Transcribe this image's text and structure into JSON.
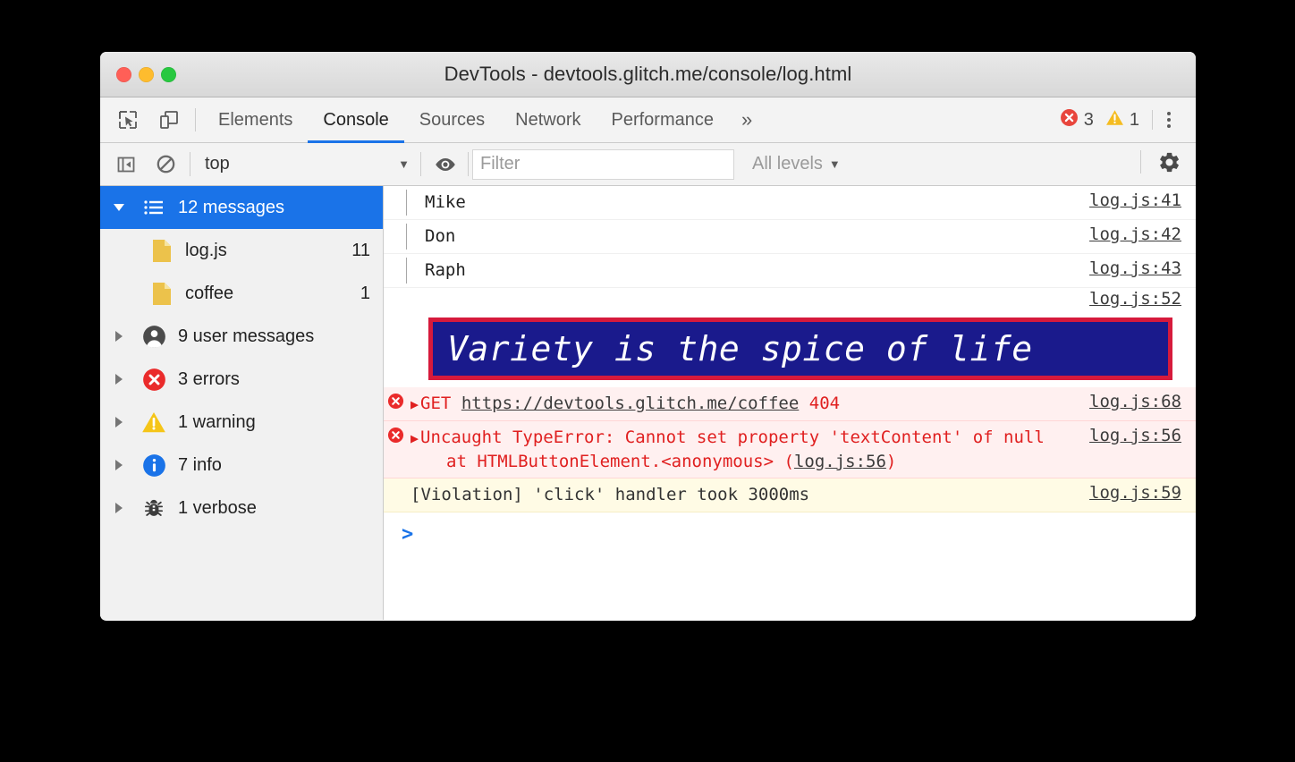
{
  "window": {
    "title": "DevTools - devtools.glitch.me/console/log.html",
    "traffic_lights": [
      "close-red",
      "minimize-yellow",
      "maximize-green"
    ]
  },
  "toolbar": {
    "inspect_icon": "inspect-element-icon",
    "device_icon": "device-toolbar-icon",
    "tabs": [
      {
        "label": "Elements",
        "active": false
      },
      {
        "label": "Console",
        "active": true
      },
      {
        "label": "Sources",
        "active": false
      },
      {
        "label": "Network",
        "active": false
      },
      {
        "label": "Performance",
        "active": false
      }
    ],
    "more_tabs_label": "»",
    "error_count": "3",
    "warning_count": "1",
    "menu_icon": "kebab-menu-icon"
  },
  "filterbar": {
    "sidebar_toggle_icon": "show-console-sidebar-icon",
    "clear_icon": "clear-console-icon",
    "context_value": "top",
    "context_caret": "▼",
    "live_expression_icon": "eye-icon",
    "filter_placeholder": "Filter",
    "filter_value": "",
    "levels_label": "All levels",
    "levels_caret": "▼",
    "settings_icon": "gear-icon"
  },
  "sidebar": {
    "items": [
      {
        "label": "12 messages",
        "count": "",
        "icon": "list-icon",
        "twisty": "down",
        "selected": true,
        "child": false
      },
      {
        "label": "log.js",
        "count": "11",
        "icon": "file-icon",
        "twisty": "",
        "selected": false,
        "child": true
      },
      {
        "label": "coffee",
        "count": "1",
        "icon": "file-icon",
        "twisty": "",
        "selected": false,
        "child": true
      },
      {
        "label": "9 user messages",
        "count": "",
        "icon": "user-icon",
        "twisty": "right",
        "selected": false,
        "child": false
      },
      {
        "label": "3 errors",
        "count": "",
        "icon": "error-icon",
        "twisty": "right",
        "selected": false,
        "child": false
      },
      {
        "label": "1 warning",
        "count": "",
        "icon": "warning-icon",
        "twisty": "right",
        "selected": false,
        "child": false
      },
      {
        "label": "7 info",
        "count": "",
        "icon": "info-icon",
        "twisty": "right",
        "selected": false,
        "child": false
      },
      {
        "label": "1 verbose",
        "count": "",
        "icon": "bug-icon",
        "twisty": "right",
        "selected": false,
        "child": false
      }
    ]
  },
  "console": {
    "messages": [
      {
        "kind": "group-item",
        "text": "Mike",
        "source": "log.js:41"
      },
      {
        "kind": "group-item",
        "text": "Don",
        "source": "log.js:42"
      },
      {
        "kind": "group-item",
        "text": "Raph",
        "source": "log.js:43"
      },
      {
        "kind": "styled",
        "text": "Variety is the spice of life",
        "source": "log.js:52",
        "text_color": "#ffffff",
        "background_color": "#1a1a8c",
        "border_color": "#d61a3c"
      },
      {
        "kind": "error-network",
        "method": "GET",
        "url": "https://devtools.glitch.me/coffee",
        "status": "404",
        "source": "log.js:68"
      },
      {
        "kind": "error-exception",
        "text": "Uncaught TypeError: Cannot set property 'textContent' of null",
        "stack_prefix": "at HTMLButtonElement.<anonymous> (",
        "stack_link": "log.js:56",
        "stack_suffix": ")",
        "source": "log.js:56"
      },
      {
        "kind": "warning",
        "text": "[Violation] 'click' handler took 3000ms",
        "source": "log.js:59"
      }
    ],
    "prompt_symbol": ">",
    "prompt_value": ""
  },
  "colors": {
    "accent_blue": "#1a73e8",
    "error_red": "#e82b2b",
    "warning_yellow": "#f5c518",
    "info_blue": "#1a73e8",
    "error_bg": "#fff0f0",
    "warning_bg": "#fffbe5"
  }
}
